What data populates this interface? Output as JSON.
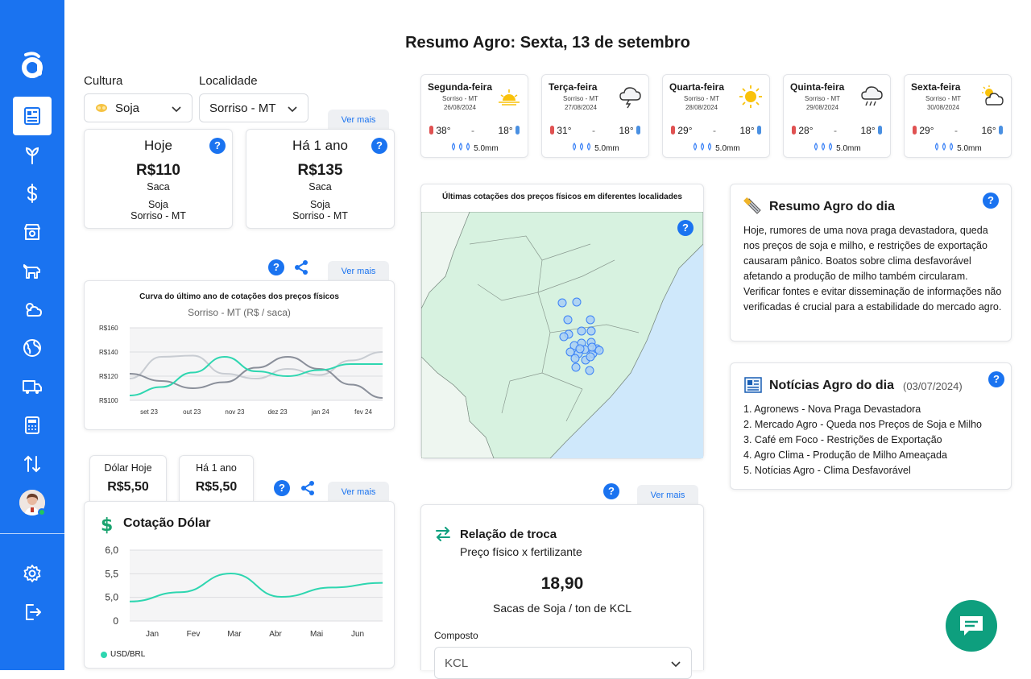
{
  "page": {
    "title": "Resumo Agro: Sexta, 13 de setembro"
  },
  "colors": {
    "sidebar": "#1a73f0",
    "accent": "#1a73f0",
    "chart_line": "#2ed6b0",
    "chat_button": "#0e9f7e"
  },
  "sidebar": {
    "logo_icon": "app-logo-a",
    "items": [
      {
        "icon": "dashboard-icon",
        "active": true
      },
      {
        "icon": "plant-sprout-icon"
      },
      {
        "icon": "dollar-icon"
      },
      {
        "icon": "store-icon"
      },
      {
        "icon": "cattle-icon"
      },
      {
        "icon": "weather-icon"
      },
      {
        "icon": "globe-icon"
      },
      {
        "icon": "truck-icon"
      },
      {
        "icon": "calculator-icon"
      },
      {
        "icon": "sort-arrows-icon"
      }
    ],
    "bottom": [
      {
        "icon": "settings-icon"
      },
      {
        "icon": "logout-icon"
      }
    ]
  },
  "filters": {
    "culture_label": "Cultura",
    "culture_value": "Soja",
    "location_label": "Localidade",
    "location_value": "Sorriso - MT"
  },
  "ver_mais": "Ver mais",
  "help": "?",
  "price_today": {
    "title": "Hoje",
    "value": "R$110",
    "unit": "Saca",
    "product": "Soja",
    "location": "Sorriso - MT"
  },
  "price_year": {
    "title": "Há 1 ano",
    "value": "R$135",
    "unit": "Saca",
    "product": "Soja",
    "location": "Sorriso - MT"
  },
  "price_chart": {
    "title": "Curva do último ano de cotações dos preços físicos",
    "subtitle": "Sorriso - MT   (R$ / saca)"
  },
  "dolar": {
    "today_label": "Dólar Hoje",
    "today_value": "R$5,50",
    "year_label": "Há 1 ano",
    "year_value": "R$5,50",
    "card_title": "Cotação Dólar",
    "legend": "USD/BRL"
  },
  "weather": [
    {
      "day": "Segunda-feira",
      "loc": "Sorriso - MT",
      "date": "26/08/2024",
      "icon": "sunrise-icon",
      "max": "38°",
      "min": "18°",
      "rain": "5.0mm"
    },
    {
      "day": "Terça-feira",
      "loc": "Sorriso - MT",
      "date": "27/08/2024",
      "icon": "storm-cloud-icon",
      "max": "31°",
      "min": "18°",
      "rain": "5.0mm"
    },
    {
      "day": "Quarta-feira",
      "loc": "Sorriso - MT",
      "date": "28/08/2024",
      "icon": "sun-icon",
      "max": "29°",
      "min": "18°",
      "rain": "5.0mm"
    },
    {
      "day": "Quinta-feira",
      "loc": "Sorriso - MT",
      "date": "29/08/2024",
      "icon": "rain-cloud-icon",
      "max": "28°",
      "min": "18°",
      "rain": "5.0mm"
    },
    {
      "day": "Sexta-feira",
      "loc": "Sorriso - MT",
      "date": "30/08/2024",
      "icon": "partly-cloudy-icon",
      "max": "29°",
      "min": "16°",
      "rain": "5.0mm"
    }
  ],
  "weather_dash": "-",
  "map": {
    "title": "Últimas cotações dos preços físicos em diferentes localidades"
  },
  "resumo": {
    "title": "Resumo Agro do dia",
    "text": "Hoje, rumores de uma nova praga devastadora, queda nos preços de soja e milho, e restrições de exportação causaram pânico. Boatos sobre clima desfavorável afetando a produção de milho também circularam. Verificar fontes e evitar disseminação de informações não verificadas é crucial para a estabilidade do mercado agro."
  },
  "noticias": {
    "title": "Notícias Agro do dia",
    "date": "(03/07/2024)",
    "items": [
      "1. Agronews - Nova Praga Devastadora",
      "2. Mercado Agro - Queda nos Preços de Soja e Milho",
      "3. Café em Foco - Restrições de Exportação",
      "4. Agro Clima - Produção de Milho Ameaçada",
      "5. Notícias Agro - Clima Desfavorável"
    ]
  },
  "troca": {
    "title": "Relação de troca",
    "subtitle": "Preço físico x fertilizante",
    "value": "18,90",
    "unit": "Sacas de Soja / ton de KCL",
    "composto_label": "Composto",
    "composto_value": "KCL"
  },
  "chart_data": [
    {
      "type": "line",
      "title": "Curva do último ano de cotações dos preços físicos",
      "subtitle": "Sorriso - MT   (R$ / saca)",
      "categories": [
        "set 23",
        "out 23",
        "nov 23",
        "dez 23",
        "jan 24",
        "fev 24"
      ],
      "y_ticks": [
        "R$160",
        "R$140",
        "R$120",
        "R$100"
      ],
      "ylim": [
        100,
        160
      ],
      "series": [
        {
          "color": "#2ed6b0",
          "values": [
            104,
            111,
            123,
            136,
            124,
            120,
            125,
            130,
            130
          ]
        },
        {
          "color": "#8a8f9a",
          "values": [
            122,
            116,
            110,
            115,
            127,
            136,
            126,
            113,
            102
          ]
        },
        {
          "color": "#c8ccd2",
          "values": [
            118,
            136,
            137,
            122,
            118,
            126,
            121,
            133,
            140
          ]
        }
      ]
    },
    {
      "type": "line",
      "title": "",
      "categories": [
        "Jan",
        "Fev",
        "Mar",
        "Abr",
        "Mai",
        "Jun"
      ],
      "y_ticks": [
        "6,0",
        "5,5",
        "5,0",
        "0"
      ],
      "series": [
        {
          "name": "USD/BRL",
          "color": "#2ed6b0",
          "values": [
            4.9,
            5.1,
            5.5,
            5.0,
            5.2,
            5.3
          ]
        }
      ]
    }
  ]
}
